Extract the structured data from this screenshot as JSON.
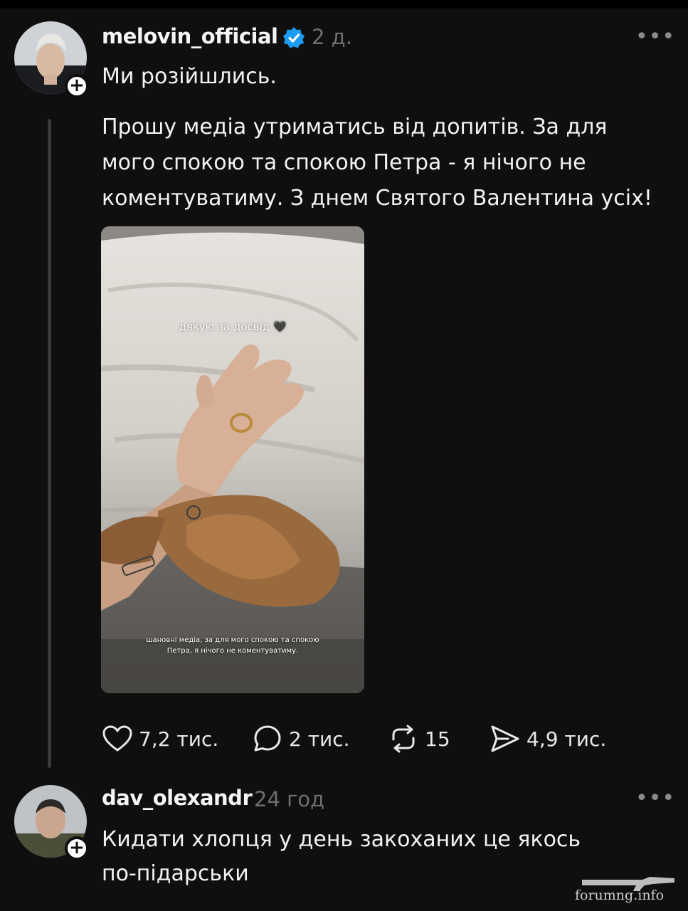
{
  "post": {
    "username": "melovin_official",
    "time": "2 д.",
    "more": "•••",
    "first_line": "Ми розійшлись.",
    "paragraph": [
      "Прошу медіа утриматись від допитів. За для",
      "мого спокою та спокою Петра - я нічого не",
      "коментуватиму. З днем Святого Валентина усіх!"
    ],
    "story_top_text": "дякую за досвід 🖤",
    "story_bottom_text": [
      "шановні медіа, за для мого спокою та спокою",
      "Петра, я нічого не коментуватиму."
    ],
    "likes": "7,2 тис.",
    "replies": "2 тис.",
    "reposts": "15",
    "shares": "4,9 тис."
  },
  "reply": {
    "username": "dav_olexandr",
    "time": "24 год",
    "more": "•••",
    "lines": [
      "Кидати хлопця у день закоханих це якось",
      "по-підарськи"
    ]
  },
  "follow_symbol": "+",
  "watermark": "forumng.info",
  "colors": {
    "background": "#0f0f10",
    "verified": "#1d9bf0",
    "muted": "#6e6e73",
    "thread_line": "#3a3a3c"
  }
}
